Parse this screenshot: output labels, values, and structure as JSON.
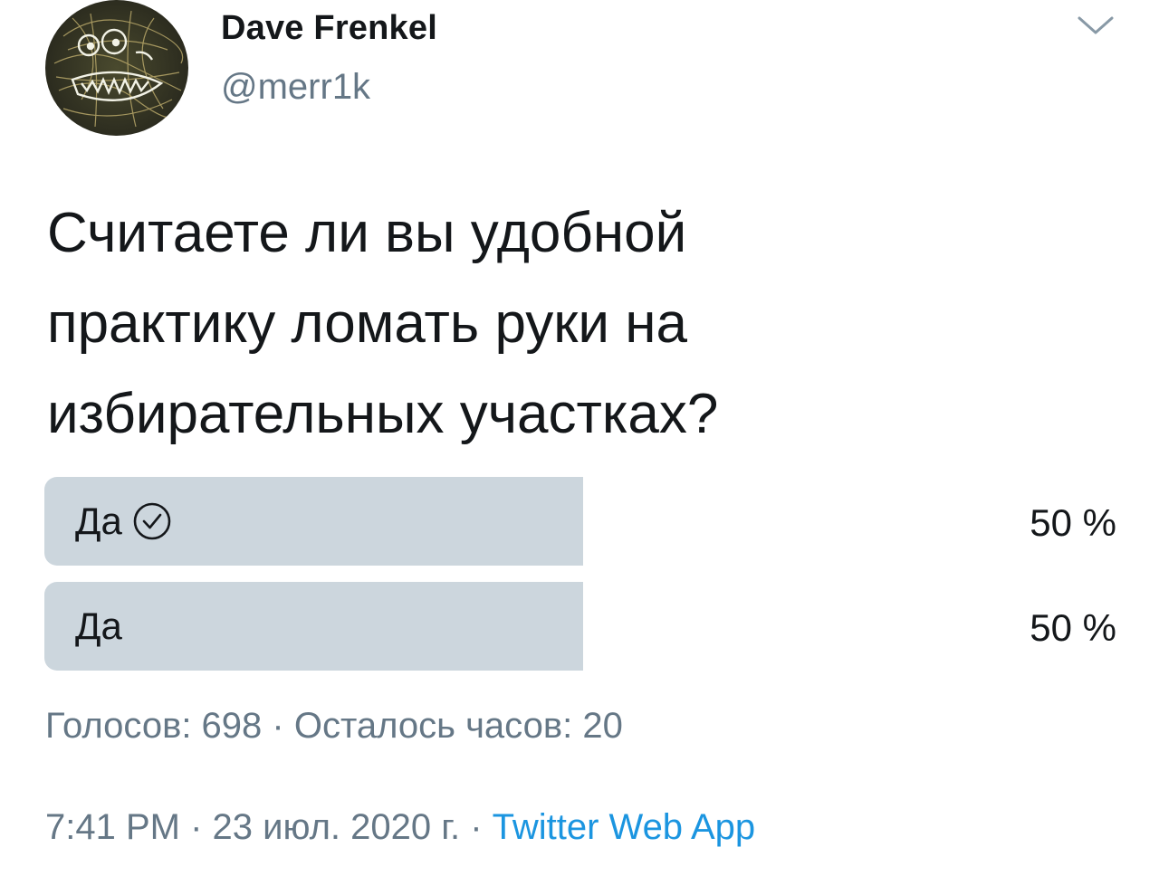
{
  "author": {
    "display_name": "Dave Frenkel",
    "handle": "@merr1k",
    "avatar_icon": "scribble-monster-avatar"
  },
  "header": {
    "more_icon": "chevron-down-icon"
  },
  "tweet": {
    "text_lines": [
      "Считаете ли вы удобной",
      "практику ломать руки на",
      "избирательных участках?"
    ]
  },
  "poll": {
    "options": [
      {
        "label": "Да",
        "percent": "50 %",
        "share": 0.5,
        "selected": true,
        "selected_icon": "check-circle-icon"
      },
      {
        "label": "Да",
        "percent": "50 %",
        "share": 0.5,
        "selected": false
      }
    ],
    "meta": "Голосов: 698 · Осталось часов: 20",
    "bar_color": "#ccd6dd"
  },
  "footer": {
    "timestamp": "7:41 PM · 23 июл. 2020 г.",
    "separator": " · ",
    "source": "Twitter Web App"
  },
  "colors": {
    "text_primary": "#14171a",
    "text_secondary": "#657786",
    "link": "#1b95e0"
  }
}
